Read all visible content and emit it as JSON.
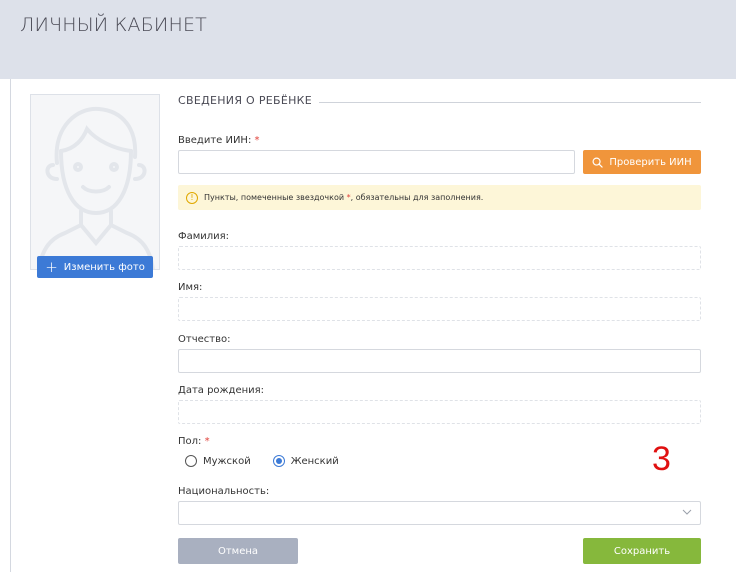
{
  "header": {
    "title": "ЛИЧНЫЙ КАБИНЕТ"
  },
  "photo": {
    "change_button_label": "Изменить фото",
    "plus_icon": "+"
  },
  "section": {
    "title": "СВЕДЕНИЯ О РЕБЁНКЕ"
  },
  "iin": {
    "label": "Введите ИИН:",
    "required_mark": "*",
    "value": "",
    "check_button_label": "Проверить ИИН",
    "check_icon": "search-icon"
  },
  "notice": {
    "icon": "ⓘ",
    "text_before": "Пункты, помеченные звездочкой ",
    "mark": "*",
    "text_after": ", обязательны для заполнения."
  },
  "fields": {
    "surname": {
      "label": "Фамилия:",
      "value": ""
    },
    "name": {
      "label": "Имя:",
      "value": ""
    },
    "patronymic": {
      "label": "Отчество:",
      "value": ""
    },
    "birthdate": {
      "label": "Дата рождения:",
      "placeholder": ""
    }
  },
  "gender": {
    "label": "Пол:",
    "required_mark": "*",
    "options": [
      {
        "label": "Мужской",
        "checked": false
      },
      {
        "label": "Женский",
        "checked": true
      }
    ]
  },
  "nationality": {
    "label": "Национальность:",
    "value": ""
  },
  "annotation": {
    "number": "3"
  },
  "actions": {
    "cancel_label": "Отмена",
    "save_label": "Сохранить"
  },
  "colors": {
    "header_bg": "#dde1ea",
    "primary_blue": "#3c7ad6",
    "orange": "#f0953b",
    "green": "#86b83c",
    "gray_button": "#a9b0c0",
    "required_red": "#e0413a",
    "notice_bg": "#fdf6d8"
  }
}
